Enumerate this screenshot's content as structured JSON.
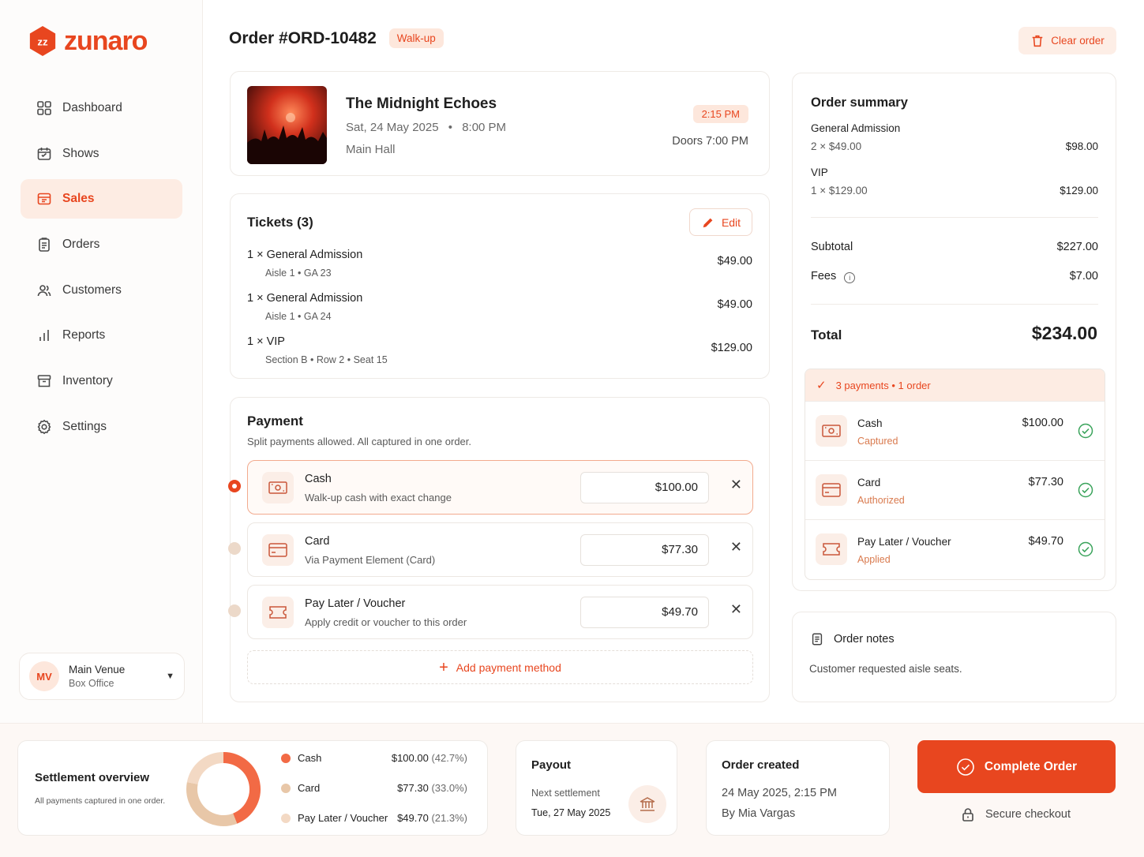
{
  "brand": {
    "name": "zunaro",
    "color": "#e8461f"
  },
  "nav": [
    {
      "label": "Dashboard",
      "icon": "grid-icon",
      "active": false
    },
    {
      "label": "Shows",
      "icon": "calendar-icon",
      "active": false
    },
    {
      "label": "Sales",
      "icon": "ticket-icon",
      "active": true
    },
    {
      "label": "Orders",
      "icon": "clipboard-icon",
      "active": false
    },
    {
      "label": "Customers",
      "icon": "users-icon",
      "active": false
    },
    {
      "label": "Reports",
      "icon": "bar-chart-icon",
      "active": false
    },
    {
      "label": "Inventory",
      "icon": "archive-icon",
      "active": false
    },
    {
      "label": "Settings",
      "icon": "gear-icon",
      "active": false
    }
  ],
  "venue": {
    "initials": "MV",
    "name": "Main Venue",
    "role": "Box Office"
  },
  "order": {
    "title": "Order #ORD-10482",
    "badge": "Walk-up",
    "clear_label": "Clear order"
  },
  "event": {
    "title": "The Midnight Echoes",
    "date": "Sat, 24 May 2025",
    "time": "8:00 PM",
    "hall": "Main Hall",
    "time_pill": "2:15 PM",
    "doors": "Doors 7:00 PM"
  },
  "tickets": {
    "title": "Tickets (3)",
    "edit_label": "Edit",
    "items": [
      {
        "qty": "1 ×",
        "name": "General Admission",
        "detail": "Aisle 1 • GA 23",
        "price": "$49.00"
      },
      {
        "qty": "1 ×",
        "name": "General Admission",
        "detail": "Aisle 1 • GA 24",
        "price": "$49.00"
      },
      {
        "qty": "1 ×",
        "name": "VIP",
        "detail": "Section B • Row 2 • Seat 15",
        "price": "$129.00"
      }
    ]
  },
  "payment": {
    "title": "Payment",
    "subtitle": "Split payments allowed. All captured in one order.",
    "methods": [
      {
        "name": "Cash",
        "desc": "Walk-up cash with exact change",
        "amount": "$100.00",
        "icon": "cash-icon",
        "selected": true
      },
      {
        "name": "Card",
        "desc": "Via Payment Element (Card)",
        "amount": "$77.30",
        "icon": "card-icon",
        "selected": false
      },
      {
        "name": "Pay Later / Voucher",
        "desc": "Apply credit or voucher to this order",
        "amount": "$49.70",
        "icon": "voucher-icon",
        "selected": false
      }
    ],
    "add_label": "Add payment method"
  },
  "summary": {
    "title": "Order summary",
    "lines": [
      {
        "name": "General Admission",
        "qty": "2 × $49.00",
        "total": "$98.00"
      },
      {
        "name": "VIP",
        "qty": "1 × $129.00",
        "total": "$129.00"
      }
    ],
    "subtotal_label": "Subtotal",
    "subtotal": "$227.00",
    "fees_label": "Fees",
    "fees": "$7.00",
    "total_label": "Total",
    "total": "$234.00",
    "payments_header": "3 payments • 1 order",
    "payments": [
      {
        "name": "Cash",
        "status": "Captured",
        "amount": "$100.00",
        "icon": "cash-icon"
      },
      {
        "name": "Card",
        "status": "Authorized",
        "amount": "$77.30",
        "icon": "card-icon"
      },
      {
        "name": "Pay Later / Voucher",
        "status": "Applied",
        "amount": "$49.70",
        "icon": "voucher-icon"
      }
    ]
  },
  "notes": {
    "title": "Order notes",
    "text": "Customer requested aisle seats."
  },
  "settlement": {
    "title": "Settlement overview",
    "subtitle": "All payments captured in one order.",
    "items": [
      {
        "name": "Cash",
        "amount": "$100.00",
        "pct": "(42.7%)",
        "share": 42.7,
        "color": "#f26a45"
      },
      {
        "name": "Card",
        "amount": "$77.30",
        "pct": "(33.0%)",
        "share": 33.0,
        "color": "#e8c7a8"
      },
      {
        "name": "Pay Later / Voucher",
        "amount": "$49.70",
        "pct": "(21.3%)",
        "share": 21.3,
        "color": "#f3d9c4"
      }
    ]
  },
  "payout": {
    "title": "Payout",
    "label": "Next settlement",
    "date": "Tue, 27 May 2025"
  },
  "created": {
    "title": "Order created",
    "when": "24 May 2025, 2:15 PM",
    "by": "By Mia Vargas"
  },
  "actions": {
    "complete_label": "Complete Order",
    "secure_label": "Secure checkout"
  }
}
